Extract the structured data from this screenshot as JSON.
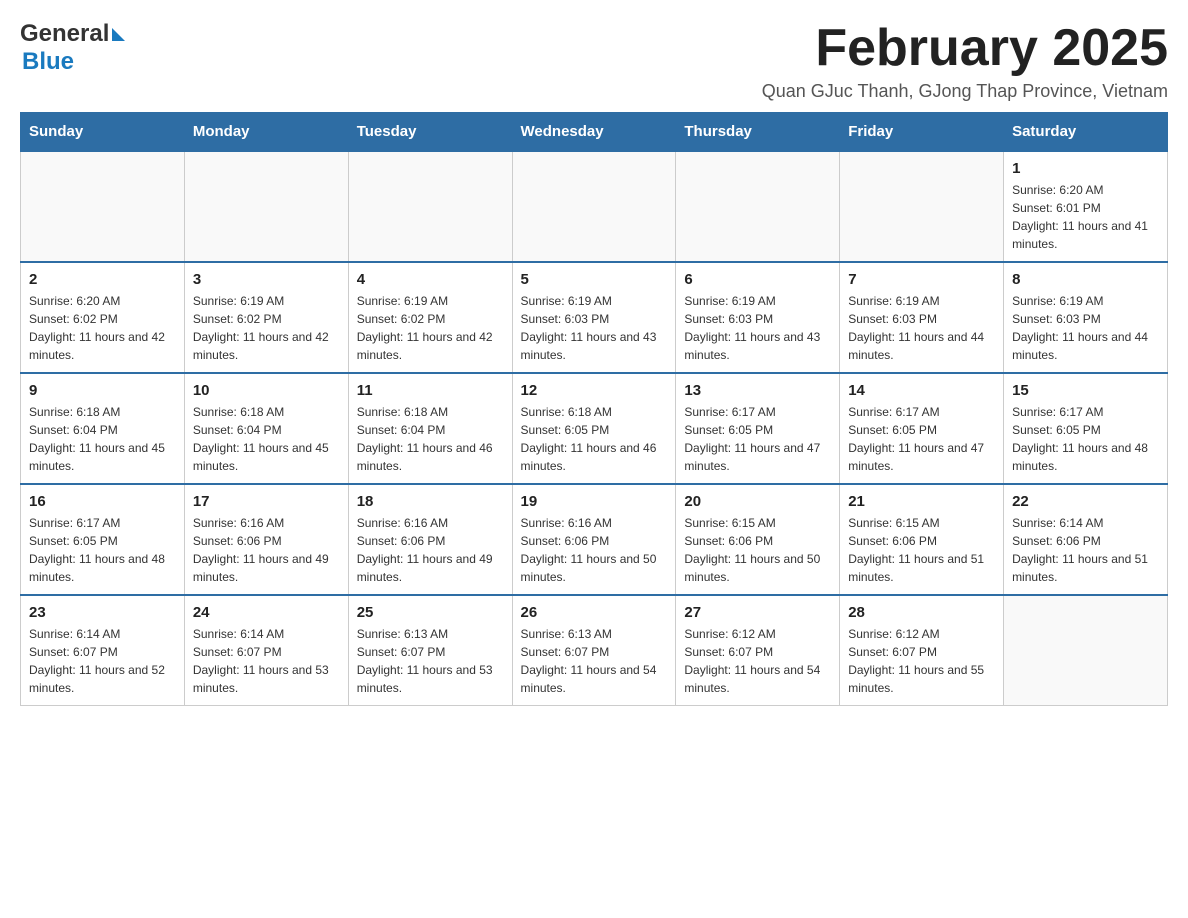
{
  "header": {
    "logo": {
      "general": "General",
      "blue": "Blue"
    },
    "title": "February 2025",
    "location": "Quan GJuc Thanh, GJong Thap Province, Vietnam"
  },
  "calendar": {
    "days_of_week": [
      "Sunday",
      "Monday",
      "Tuesday",
      "Wednesday",
      "Thursday",
      "Friday",
      "Saturday"
    ],
    "weeks": [
      [
        {
          "day": "",
          "info": ""
        },
        {
          "day": "",
          "info": ""
        },
        {
          "day": "",
          "info": ""
        },
        {
          "day": "",
          "info": ""
        },
        {
          "day": "",
          "info": ""
        },
        {
          "day": "",
          "info": ""
        },
        {
          "day": "1",
          "info": "Sunrise: 6:20 AM\nSunset: 6:01 PM\nDaylight: 11 hours and 41 minutes."
        }
      ],
      [
        {
          "day": "2",
          "info": "Sunrise: 6:20 AM\nSunset: 6:02 PM\nDaylight: 11 hours and 42 minutes."
        },
        {
          "day": "3",
          "info": "Sunrise: 6:19 AM\nSunset: 6:02 PM\nDaylight: 11 hours and 42 minutes."
        },
        {
          "day": "4",
          "info": "Sunrise: 6:19 AM\nSunset: 6:02 PM\nDaylight: 11 hours and 42 minutes."
        },
        {
          "day": "5",
          "info": "Sunrise: 6:19 AM\nSunset: 6:03 PM\nDaylight: 11 hours and 43 minutes."
        },
        {
          "day": "6",
          "info": "Sunrise: 6:19 AM\nSunset: 6:03 PM\nDaylight: 11 hours and 43 minutes."
        },
        {
          "day": "7",
          "info": "Sunrise: 6:19 AM\nSunset: 6:03 PM\nDaylight: 11 hours and 44 minutes."
        },
        {
          "day": "8",
          "info": "Sunrise: 6:19 AM\nSunset: 6:03 PM\nDaylight: 11 hours and 44 minutes."
        }
      ],
      [
        {
          "day": "9",
          "info": "Sunrise: 6:18 AM\nSunset: 6:04 PM\nDaylight: 11 hours and 45 minutes."
        },
        {
          "day": "10",
          "info": "Sunrise: 6:18 AM\nSunset: 6:04 PM\nDaylight: 11 hours and 45 minutes."
        },
        {
          "day": "11",
          "info": "Sunrise: 6:18 AM\nSunset: 6:04 PM\nDaylight: 11 hours and 46 minutes."
        },
        {
          "day": "12",
          "info": "Sunrise: 6:18 AM\nSunset: 6:05 PM\nDaylight: 11 hours and 46 minutes."
        },
        {
          "day": "13",
          "info": "Sunrise: 6:17 AM\nSunset: 6:05 PM\nDaylight: 11 hours and 47 minutes."
        },
        {
          "day": "14",
          "info": "Sunrise: 6:17 AM\nSunset: 6:05 PM\nDaylight: 11 hours and 47 minutes."
        },
        {
          "day": "15",
          "info": "Sunrise: 6:17 AM\nSunset: 6:05 PM\nDaylight: 11 hours and 48 minutes."
        }
      ],
      [
        {
          "day": "16",
          "info": "Sunrise: 6:17 AM\nSunset: 6:05 PM\nDaylight: 11 hours and 48 minutes."
        },
        {
          "day": "17",
          "info": "Sunrise: 6:16 AM\nSunset: 6:06 PM\nDaylight: 11 hours and 49 minutes."
        },
        {
          "day": "18",
          "info": "Sunrise: 6:16 AM\nSunset: 6:06 PM\nDaylight: 11 hours and 49 minutes."
        },
        {
          "day": "19",
          "info": "Sunrise: 6:16 AM\nSunset: 6:06 PM\nDaylight: 11 hours and 50 minutes."
        },
        {
          "day": "20",
          "info": "Sunrise: 6:15 AM\nSunset: 6:06 PM\nDaylight: 11 hours and 50 minutes."
        },
        {
          "day": "21",
          "info": "Sunrise: 6:15 AM\nSunset: 6:06 PM\nDaylight: 11 hours and 51 minutes."
        },
        {
          "day": "22",
          "info": "Sunrise: 6:14 AM\nSunset: 6:06 PM\nDaylight: 11 hours and 51 minutes."
        }
      ],
      [
        {
          "day": "23",
          "info": "Sunrise: 6:14 AM\nSunset: 6:07 PM\nDaylight: 11 hours and 52 minutes."
        },
        {
          "day": "24",
          "info": "Sunrise: 6:14 AM\nSunset: 6:07 PM\nDaylight: 11 hours and 53 minutes."
        },
        {
          "day": "25",
          "info": "Sunrise: 6:13 AM\nSunset: 6:07 PM\nDaylight: 11 hours and 53 minutes."
        },
        {
          "day": "26",
          "info": "Sunrise: 6:13 AM\nSunset: 6:07 PM\nDaylight: 11 hours and 54 minutes."
        },
        {
          "day": "27",
          "info": "Sunrise: 6:12 AM\nSunset: 6:07 PM\nDaylight: 11 hours and 54 minutes."
        },
        {
          "day": "28",
          "info": "Sunrise: 6:12 AM\nSunset: 6:07 PM\nDaylight: 11 hours and 55 minutes."
        },
        {
          "day": "",
          "info": ""
        }
      ]
    ]
  }
}
